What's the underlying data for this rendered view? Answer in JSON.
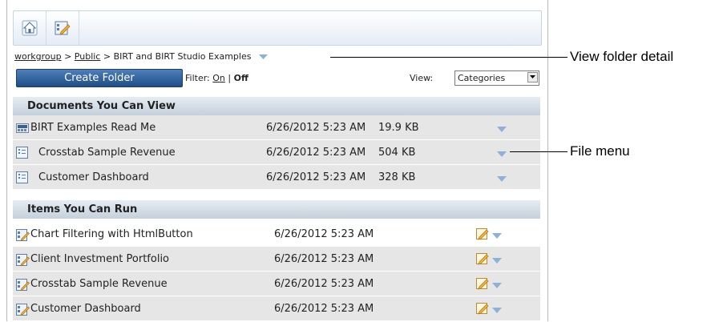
{
  "toolbar": {
    "home_icon": "home-icon",
    "report_icon": "report-design-icon"
  },
  "breadcrumb": {
    "items": [
      "workgroup",
      "Public",
      "BIRT and BIRT Studio Examples"
    ],
    "separator": ">"
  },
  "actions": {
    "create_folder": "Create Folder",
    "filter_label": "Filter:",
    "filter_on": "On",
    "filter_sep": "|",
    "filter_off": "Off",
    "view_label": "View:",
    "view_value": "Categories"
  },
  "documents": {
    "header": "Documents You Can View",
    "rows": [
      {
        "name": "BIRT Examples Read Me",
        "date": "6/26/2012 5:23 AM",
        "size": "19.9 KB",
        "icon": "pdf-document-icon"
      },
      {
        "name": "Crosstab Sample Revenue",
        "date": "6/26/2012 5:23 AM",
        "size": " 504 KB",
        "icon": "report-document-icon"
      },
      {
        "name": "Customer Dashboard",
        "date": "6/26/2012 5:23 AM",
        "size": " 328 KB",
        "icon": "report-document-icon"
      }
    ]
  },
  "runnable": {
    "header": "Items You Can Run",
    "rows": [
      {
        "name": "Chart Filtering with HtmlButton",
        "date": "6/26/2012 5:23 AM",
        "icon": "report-design-icon"
      },
      {
        "name": "Client Investment Portfolio",
        "date": "6/26/2012 5:23 AM",
        "icon": "report-design-icon"
      },
      {
        "name": "Crosstab Sample Revenue",
        "date": "6/26/2012 5:23 AM",
        "icon": "report-design-icon"
      },
      {
        "name": "Customer Dashboard",
        "date": "6/26/2012 5:23 AM",
        "icon": "report-design-icon"
      }
    ]
  },
  "callouts": {
    "folder_detail": "View folder detail",
    "file_menu": "File menu"
  },
  "colors": {
    "menu_arrow": "#8fb0d8",
    "button_blue": "#1f4e86",
    "header_gray": "#c4d0dc",
    "row_gray": "#e6e6e6"
  }
}
